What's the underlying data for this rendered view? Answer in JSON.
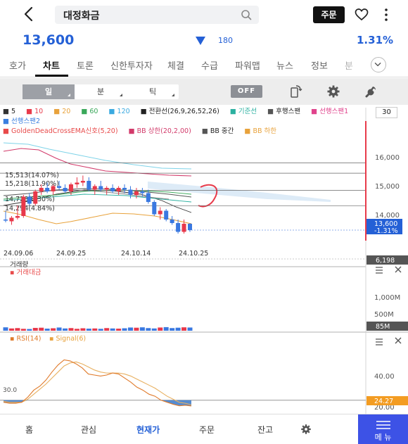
{
  "header": {
    "search_value": "대정화금",
    "order_label": "주문"
  },
  "quote": {
    "price": "13,600",
    "change": "180",
    "change_pct": "1.31%",
    "color": "#2460d6"
  },
  "tabs": [
    {
      "label": "호가",
      "active": false
    },
    {
      "label": "차트",
      "active": true
    },
    {
      "label": "토론",
      "active": false
    },
    {
      "label": "신한투자자",
      "active": false
    },
    {
      "label": "체결",
      "active": false
    },
    {
      "label": "수급",
      "active": false
    },
    {
      "label": "파워맵",
      "active": false
    },
    {
      "label": "뉴스",
      "active": false
    },
    {
      "label": "정보",
      "active": false
    },
    {
      "label": "분",
      "active": false
    }
  ],
  "chart_toolbar": {
    "periods": [
      "일",
      "분",
      "틱"
    ],
    "off_label": "OFF"
  },
  "legend": {
    "items": [
      {
        "label": "5",
        "color": "#333333"
      },
      {
        "label": "10",
        "color": "#e83b4b"
      },
      {
        "label": "20",
        "color": "#e8a23b"
      },
      {
        "label": "60",
        "color": "#39a85a"
      },
      {
        "label": "120",
        "color": "#3aa9e0"
      },
      {
        "label": "전환선(26,9,26,52,26)",
        "color": "#222222"
      },
      {
        "label": "기준선",
        "color": "#2bb0a0"
      },
      {
        "label": "후행스팬",
        "color": "#555555"
      },
      {
        "label": "선행스팬1",
        "color": "#e0438c"
      },
      {
        "label": "선행스팬2",
        "color": "#3a7fe0"
      },
      {
        "label": "GoldenDeadCrossEMA신호(5,20)",
        "color": "#e84a4a"
      },
      {
        "label": "BB 상한(20,2,00)",
        "color": "#d23a6a"
      },
      {
        "label": "BB 중간",
        "color": "#555555"
      },
      {
        "label": "BB 하한",
        "color": "#e8a23b"
      }
    ],
    "period_count": "30"
  },
  "chart_data": [
    {
      "type": "candlestick",
      "x_ticks": [
        "24.09.06",
        "24.09.25",
        "24.10.14",
        "24.10.25"
      ],
      "y_ticks": [
        "16,000",
        "15,000",
        "14,000"
      ],
      "ylim": [
        13300,
        16700
      ],
      "annotations": [
        "15,513(14.07%)",
        "15,218(11.90%)",
        "14,728(8.30%)",
        "14,294(4.84%)"
      ],
      "levels": [
        15513,
        15218,
        14728,
        14294
      ],
      "current_price_label": "13,600",
      "current_pct_label": "-1.31%",
      "current_value": 13600,
      "candles": [
        {
          "o": 13900,
          "h": 14150,
          "l": 13820,
          "c": 13880
        },
        {
          "o": 13850,
          "h": 14000,
          "l": 13750,
          "c": 13950
        },
        {
          "o": 13950,
          "h": 14300,
          "l": 13900,
          "c": 14000
        },
        {
          "o": 14000,
          "h": 14600,
          "l": 13950,
          "c": 14550
        },
        {
          "o": 14550,
          "h": 14650,
          "l": 14300,
          "c": 14350
        },
        {
          "o": 14350,
          "h": 14750,
          "l": 14300,
          "c": 14700
        },
        {
          "o": 14700,
          "h": 14900,
          "l": 14600,
          "c": 14800
        },
        {
          "o": 14800,
          "h": 14950,
          "l": 14650,
          "c": 14700
        },
        {
          "o": 14700,
          "h": 14900,
          "l": 14600,
          "c": 14850
        },
        {
          "o": 14850,
          "h": 15000,
          "l": 14750,
          "c": 14800
        },
        {
          "o": 14800,
          "h": 14900,
          "l": 14650,
          "c": 14700
        },
        {
          "o": 14700,
          "h": 14950,
          "l": 14600,
          "c": 14900
        },
        {
          "o": 14900,
          "h": 15100,
          "l": 14800,
          "c": 14950
        },
        {
          "o": 14950,
          "h": 15150,
          "l": 14850,
          "c": 15000
        },
        {
          "o": 15000,
          "h": 15100,
          "l": 14700,
          "c": 14750
        },
        {
          "o": 14750,
          "h": 14900,
          "l": 14600,
          "c": 14850
        },
        {
          "o": 14850,
          "h": 15000,
          "l": 14700,
          "c": 14750
        },
        {
          "o": 14750,
          "h": 14850,
          "l": 14600,
          "c": 14800
        },
        {
          "o": 14800,
          "h": 14900,
          "l": 14650,
          "c": 14700
        },
        {
          "o": 14700,
          "h": 14850,
          "l": 14600,
          "c": 14800
        },
        {
          "o": 14800,
          "h": 14900,
          "l": 14650,
          "c": 14750
        },
        {
          "o": 14750,
          "h": 14850,
          "l": 14500,
          "c": 14600
        },
        {
          "o": 14600,
          "h": 14800,
          "l": 14500,
          "c": 14700
        },
        {
          "o": 14700,
          "h": 14800,
          "l": 14550,
          "c": 14650
        },
        {
          "o": 14650,
          "h": 14750,
          "l": 14350,
          "c": 14400
        },
        {
          "o": 14400,
          "h": 14450,
          "l": 14000,
          "c": 14050
        },
        {
          "o": 14050,
          "h": 14250,
          "l": 13900,
          "c": 14150
        },
        {
          "o": 14150,
          "h": 14200,
          "l": 13850,
          "c": 13900
        },
        {
          "o": 13900,
          "h": 14000,
          "l": 13750,
          "c": 13800
        },
        {
          "o": 13800,
          "h": 13900,
          "l": 13500,
          "c": 13550
        },
        {
          "o": 13550,
          "h": 13900,
          "l": 13500,
          "c": 13780
        },
        {
          "o": 13780,
          "h": 13800,
          "l": 13550,
          "c": 13600
        }
      ]
    },
    {
      "type": "bar",
      "title": "거래량",
      "series_name": "거래대금",
      "y_ticks": [
        "1,000M",
        "500M"
      ],
      "ylim": [
        0,
        1400
      ],
      "last_label": "85M",
      "top_label": "6,198",
      "values": [
        90,
        60,
        70,
        50,
        45,
        75,
        80,
        55,
        65,
        85,
        60,
        70,
        50,
        65,
        55,
        60,
        50,
        70,
        60,
        55,
        65,
        85,
        80,
        90,
        70,
        60,
        85,
        95,
        70,
        80,
        90,
        85
      ]
    },
    {
      "type": "line",
      "series": [
        {
          "name": "RSI(14)",
          "color": "#e07a2a"
        },
        {
          "name": "Signal(6)",
          "color": "#e8b060"
        }
      ],
      "y_ticks": [
        "40.00",
        "20.00"
      ],
      "ylim": [
        18,
        85
      ],
      "level_label": "30.0",
      "level": 30,
      "last_label": "24.27",
      "last_value": 24.27,
      "rsi": [
        28,
        27,
        27,
        28,
        33,
        40,
        44,
        50,
        58,
        65,
        70,
        69,
        66,
        62,
        56,
        55,
        54,
        55,
        57,
        56,
        52,
        48,
        43,
        40,
        36,
        34,
        30,
        28,
        26,
        24.5,
        25,
        24.3
      ],
      "signal": [
        29,
        28,
        28,
        28,
        31,
        36,
        41,
        46,
        52,
        58,
        64,
        67,
        68,
        66,
        63,
        60,
        58,
        57,
        57,
        57,
        56,
        54,
        51,
        48,
        45,
        42,
        38,
        34,
        31,
        28,
        27,
        25.5
      ]
    }
  ],
  "bottom_nav": {
    "items": [
      {
        "label": "홈",
        "active": false
      },
      {
        "label": "관심",
        "active": false
      },
      {
        "label": "현재가",
        "active": true
      },
      {
        "label": "주문",
        "active": false
      },
      {
        "label": "잔고",
        "active": false
      }
    ],
    "menu_label": "메 뉴"
  }
}
